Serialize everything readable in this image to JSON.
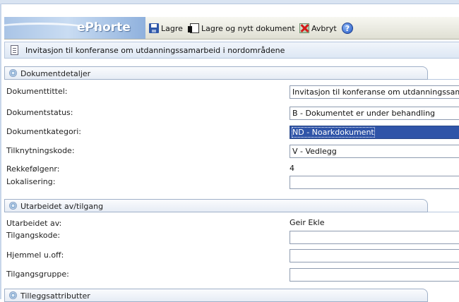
{
  "app": {
    "brand": "ePhorte"
  },
  "toolbar": {
    "save_label": "Lagre",
    "save_new_label": "Lagre og nytt dokument",
    "cancel_label": "Avbryt",
    "help_label": "?"
  },
  "document": {
    "title": "Invitasjon til konferanse om utdanningssamarbeid i nordområdene"
  },
  "sections": {
    "details": {
      "header": "Dokumentdetaljer",
      "title_label": "Dokumenttittel:",
      "title_value": "Invitasjon til konferanse om utdanningssamarbeid",
      "status_label": "Dokumentstatus:",
      "status_value": "B - Dokumentet er under behandling",
      "category_label": "Dokumentkategori:",
      "category_value": "ND - Noarkdokument",
      "link_label": "Tilknytningskode:",
      "link_value": "V - Vedlegg",
      "order_label": "Rekkefølgenr:",
      "order_value": "4",
      "location_label": "Lokalisering:",
      "location_value": ""
    },
    "access": {
      "header": "Utarbeidet av/tilgang",
      "author_label": "Utarbeidet av:",
      "author_value": "Geir Ekle",
      "access_code_label": "Tilgangskode:",
      "access_code_value": "",
      "authority_label": "Hjemmel u.off:",
      "authority_value": "",
      "access_group_label": "Tilgangsgruppe:",
      "access_group_value": ""
    },
    "extra": {
      "header": "Tilleggsattributter"
    }
  },
  "colors": {
    "selection": "#2f54a8",
    "brand_text": "#ffffff",
    "header_border": "#9fb0c8"
  }
}
